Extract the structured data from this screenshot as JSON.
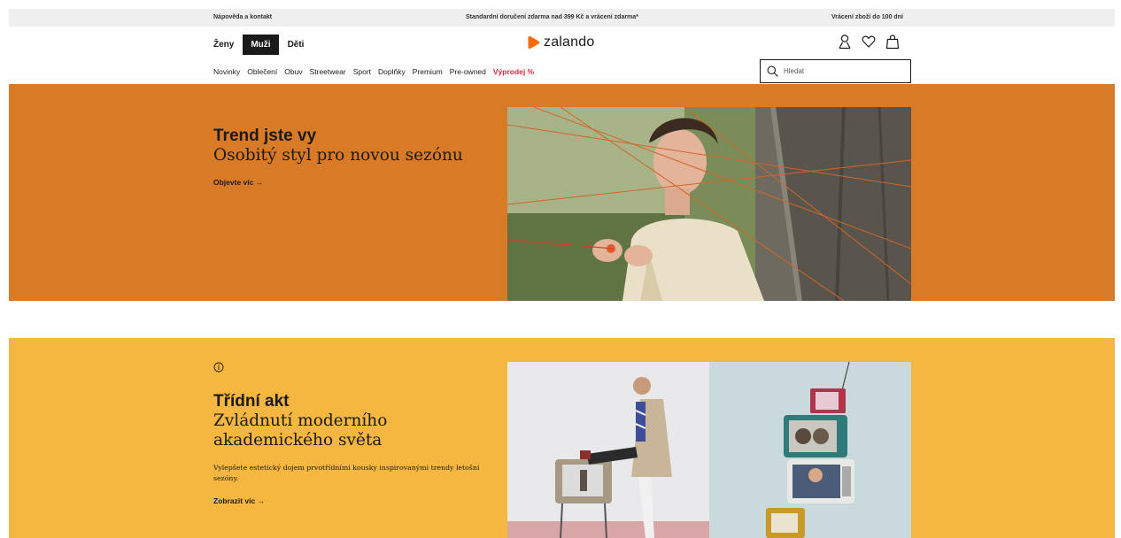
{
  "info_strip": {
    "left": "Nápověda a kontakt",
    "center": "Standardní doručení zdarma nad 399 Kč a vrácení zdarma*",
    "right": "Vrácení zboží do 100 dní"
  },
  "gender_tabs": [
    {
      "label": "Ženy",
      "active": false
    },
    {
      "label": "Muži",
      "active": true
    },
    {
      "label": "Děti",
      "active": false
    }
  ],
  "logo": {
    "text": "zalando",
    "color": "#ff6900"
  },
  "header_icons": [
    "user-icon",
    "heart-icon",
    "bag-icon"
  ],
  "categories": [
    "Novinky",
    "Oblečení",
    "Obuv",
    "Streetwear",
    "Sport",
    "Doplňky",
    "Premium",
    "Pre-owned",
    "Výprodej %"
  ],
  "search": {
    "placeholder": "Hledat"
  },
  "banner1": {
    "title": "Trend jste vy",
    "subtitle": "Osobitý styl pro novou sezónu",
    "link": "Objevte víc →",
    "background": "#d97b26"
  },
  "banner2": {
    "title": "Třídní akt",
    "subtitle": "Zvládnutí moderního akademického světa",
    "description": "Vylepšete estetický dojem prvotřídními kousky inspirovanými trendy letošní sezóny.",
    "link": "Zobrazit víc →",
    "background": "#f5b73f"
  },
  "colors": {
    "sale": "#e0263c",
    "accent": "#ff6900",
    "text": "#1a1a1a"
  }
}
